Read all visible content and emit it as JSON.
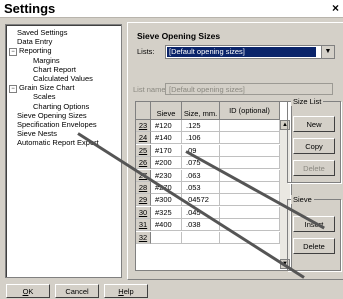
{
  "window": {
    "title": "Settings",
    "close_glyph": "×"
  },
  "tree": {
    "items": [
      {
        "label": "Saved Settings",
        "level": 1,
        "expander": ""
      },
      {
        "label": "Data Entry",
        "level": 1,
        "expander": ""
      },
      {
        "label": "Reporting",
        "level": 1,
        "expander": "−"
      },
      {
        "label": "Margins",
        "level": 2,
        "expander": ""
      },
      {
        "label": "Chart Report",
        "level": 2,
        "expander": ""
      },
      {
        "label": "Calculated Values",
        "level": 2,
        "expander": ""
      },
      {
        "label": "Grain Size Chart",
        "level": 1,
        "expander": "−"
      },
      {
        "label": "Scales",
        "level": 2,
        "expander": ""
      },
      {
        "label": "Charting Options",
        "level": 2,
        "expander": ""
      },
      {
        "label": "Sieve Opening Sizes",
        "level": 1,
        "expander": ""
      },
      {
        "label": "Specification Envelopes",
        "level": 1,
        "expander": ""
      },
      {
        "label": "Sieve Nests",
        "level": 1,
        "expander": ""
      },
      {
        "label": "Automatic Report Export",
        "level": 1,
        "expander": ""
      }
    ]
  },
  "panel": {
    "title": "Sieve Opening Sizes",
    "lists_label": "Lists:",
    "lists_value": "[Default opening sizes]",
    "list_name_label": "List name:",
    "list_name_value": "[Default opening sizes]"
  },
  "grid": {
    "headers": [
      "",
      "Sieve",
      "Size, mm.",
      "ID (optional)"
    ],
    "rows": [
      {
        "num": "23",
        "sieve": "#120",
        "size": ".125",
        "id": ""
      },
      {
        "num": "24",
        "sieve": "#140",
        "size": ".106",
        "id": ""
      },
      {
        "num": "25",
        "sieve": "#170",
        "size": ".09",
        "id": ""
      },
      {
        "num": "26",
        "sieve": "#200",
        "size": ".075",
        "id": ""
      },
      {
        "num": "27",
        "sieve": "#230",
        "size": ".063",
        "id": ""
      },
      {
        "num": "28",
        "sieve": "#270",
        "size": ".053",
        "id": ""
      },
      {
        "num": "29",
        "sieve": "#300",
        "size": ".04572",
        "id": ""
      },
      {
        "num": "30",
        "sieve": "#325",
        "size": ".045",
        "id": ""
      },
      {
        "num": "31",
        "sieve": "#400",
        "size": ".038",
        "id": ""
      },
      {
        "num": "32",
        "sieve": "",
        "size": "",
        "id": ""
      }
    ]
  },
  "size_list_group": {
    "label": "Size List",
    "new": "New",
    "copy": "Copy",
    "delete": "Delete"
  },
  "sieve_group": {
    "label": "Sieve",
    "insert": "Insert",
    "delete": "Delete"
  },
  "footer": {
    "ok": {
      "u": "O",
      "rest": "K"
    },
    "cancel": {
      "u": "",
      "rest": "Cancel"
    },
    "help": {
      "u": "H",
      "rest": "elp"
    }
  }
}
